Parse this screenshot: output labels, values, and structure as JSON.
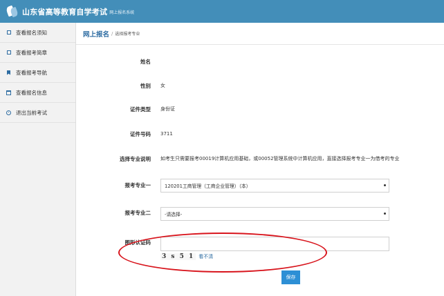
{
  "header": {
    "title": "山东省高等教育自学考试",
    "subtitle": "网上报名系统",
    "accent_color": "#438eb9"
  },
  "sidebar": {
    "items": [
      {
        "label": "查看报名须知",
        "icon": "list-icon"
      },
      {
        "label": "查看报考简章",
        "icon": "list-icon"
      },
      {
        "label": "查看报考导航",
        "icon": "bookmark-icon"
      },
      {
        "label": "查看报名信息",
        "icon": "calendar-icon"
      },
      {
        "label": "退出当前考试",
        "icon": "exit-icon"
      }
    ]
  },
  "breadcrumb": {
    "main": "网上报名",
    "separator": "/",
    "sub": "选择报考专业"
  },
  "form": {
    "name_label": "姓名",
    "name_value": "",
    "gender_label": "性别",
    "gender_value": "女",
    "id_type_label": "证件类型",
    "id_type_value": "身份证",
    "id_number_label": "证件号码",
    "id_number_value": "3711",
    "note_label": "选择专业说明",
    "note_value": "如考生只需要报考00019计算机应用基础，或00052管理系统中计算机应用，直接选择报考专业一为借考的专业",
    "major1_label": "报考专业一",
    "major1_value": "120201工商管理（工商企业管理）（本）",
    "major2_label": "报考专业二",
    "major2_value": "-请选择-",
    "captcha_label": "图形认证码",
    "captcha_input_value": "",
    "captcha_text": "3 s 5 1",
    "captcha_refresh": "看不清",
    "save_label": "保存"
  },
  "annotation_color": "#d8141c"
}
